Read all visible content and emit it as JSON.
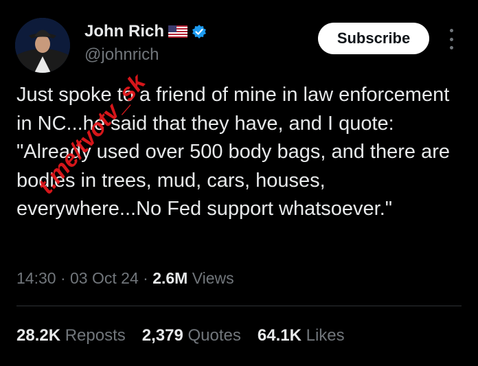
{
  "author": {
    "display_name": "John Rich",
    "handle": "@johnrich",
    "avatar": "avatar",
    "flag_icon": "us-flag-icon",
    "verified_icon": "verified-badge-icon"
  },
  "actions": {
    "subscribe_label": "Subscribe",
    "more_icon": "more-vertical-icon"
  },
  "tweet": {
    "text": "Just spoke to a friend of mine in law enforcement in NC...he said that they have, and I quote: \"Already used over 500 body bags, and there are bodies in trees, mud, cars, houses, everywhere...No Fed support whatsoever.\""
  },
  "meta": {
    "time": "14:30",
    "date": "03 Oct 24",
    "views_count": "2.6M",
    "views_label": "Views",
    "sep": "·"
  },
  "stats": {
    "reposts_count": "28.2K",
    "reposts_label": "Reposts",
    "quotes_count": "2,379",
    "quotes_label": "Quotes",
    "likes_count": "64.1K",
    "likes_label": "Likes"
  },
  "watermark": "t.me/tvotv_sk",
  "colors": {
    "background": "#000000",
    "text": "#e7e9ea",
    "secondary": "#71767b",
    "verified": "#1d9bf0",
    "watermark": "#e8181d"
  }
}
